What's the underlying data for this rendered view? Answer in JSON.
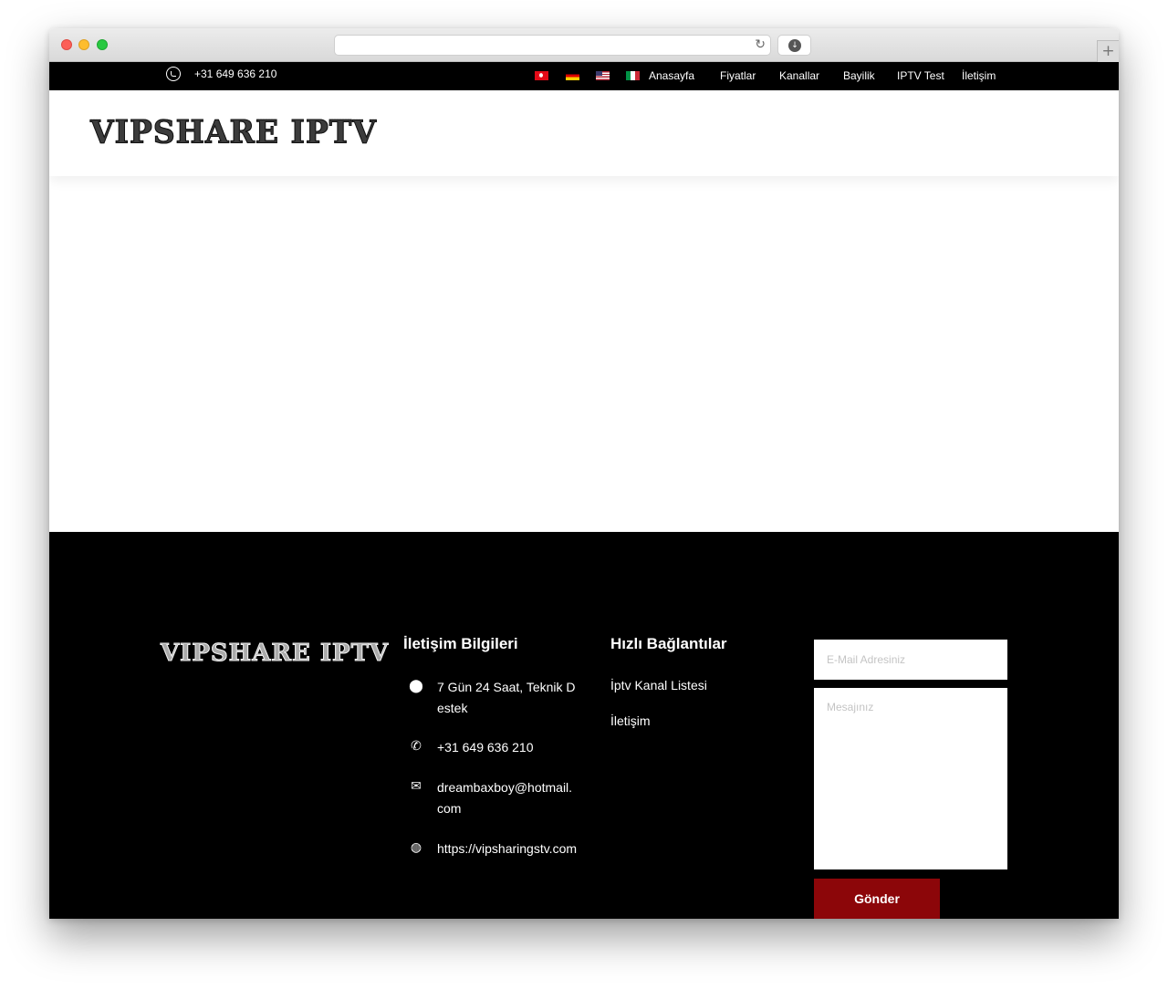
{
  "topbar": {
    "phone": "+31 649 636 210",
    "nav": [
      "Anasayfa",
      "Fiyatlar",
      "Kanallar",
      "Bayilik",
      "IPTV Test",
      "İletişim"
    ]
  },
  "header": {
    "logo_text": "VIPSHARE IPTV"
  },
  "footer": {
    "logo_text": "VIPSHARE IPTV",
    "contact_title": "İletişim Bilgileri",
    "contact": {
      "hours": "7 Gün 24 Saat, Teknik Destek",
      "phone": "+31 649 636 210",
      "email": "dreambaxboy@hotmail.com",
      "website": "https://vipsharingstv.com"
    },
    "links_title": "Hızlı Bağlantılar",
    "links": [
      "İptv Kanal Listesi",
      "İletişim"
    ],
    "form": {
      "email_placeholder": "E-Mail Adresiniz",
      "message_placeholder": "Mesajınız",
      "submit_label": "Gönder"
    }
  },
  "icons": {
    "topbar_phone": "whatsapp-icon",
    "hours": "map-marker-icon",
    "phone": "phone-icon",
    "email": "envelope-icon",
    "website": "globe-icon"
  },
  "colors": {
    "bar": "#000000",
    "button": "#8c0609"
  }
}
